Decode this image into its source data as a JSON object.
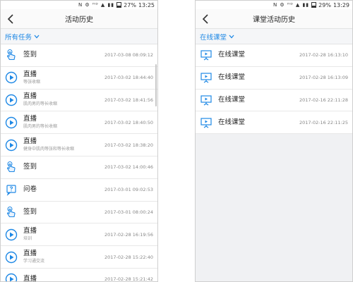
{
  "colors": {
    "accent": "#1e88e5",
    "icon_blue": "#1e88e5"
  },
  "left": {
    "status": {
      "icons": "N ⚙ ᴴᴰ ▲ ▮▮",
      "battery": "27%",
      "time": "13:25"
    },
    "title": "活动历史",
    "filter_label": "所有任务",
    "items": [
      {
        "icon": "hand-tap-icon",
        "name": "签到",
        "sub": "",
        "time": "2017-03-08 08:09:12"
      },
      {
        "icon": "play-circle-icon",
        "name": "直播",
        "sub": "等张收缩",
        "time": "2017-03-02 18:44:40"
      },
      {
        "icon": "play-circle-icon",
        "name": "直播",
        "sub": "肌肉男的等长收缩",
        "time": "2017-03-02 18:41:56"
      },
      {
        "icon": "play-circle-icon",
        "name": "直播",
        "sub": "肌肉男的等长收缩",
        "time": "2017-03-02 18:40:50"
      },
      {
        "icon": "play-circle-icon",
        "name": "直播",
        "sub": "健身中肌肉等张和等长收缩",
        "time": "2017-03-02 18:38:20"
      },
      {
        "icon": "hand-tap-icon",
        "name": "签到",
        "sub": "",
        "time": "2017-03-02 14:00:46"
      },
      {
        "icon": "questionnaire-icon",
        "name": "问卷",
        "sub": "",
        "time": "2017-03-01 09:02:53"
      },
      {
        "icon": "hand-tap-icon",
        "name": "签到",
        "sub": "",
        "time": "2017-03-01 08:00:24"
      },
      {
        "icon": "play-circle-icon",
        "name": "直播",
        "sub": "培训",
        "time": "2017-02-28 16:19:56"
      },
      {
        "icon": "play-circle-icon",
        "name": "直播",
        "sub": "学习通交流",
        "time": "2017-02-28 15:22:40"
      },
      {
        "icon": "play-circle-icon",
        "name": "直播",
        "sub": "",
        "time": "2017-02-28 15:21:42"
      }
    ]
  },
  "right": {
    "status": {
      "icons": "N ⚙ ᴴᴰ ▲ ▮▮",
      "battery": "29%",
      "time": "13:29"
    },
    "title": "课堂活动历史",
    "filter_label": "在线课堂",
    "items": [
      {
        "icon": "online-class-icon",
        "name": "在线课堂",
        "time": "2017-02-28 16:13:10"
      },
      {
        "icon": "online-class-icon",
        "name": "在线课堂",
        "time": "2017-02-28 16:13:09"
      },
      {
        "icon": "online-class-icon",
        "name": "在线课堂",
        "time": "2017-02-16 22:11:28"
      },
      {
        "icon": "online-class-icon",
        "name": "在线课堂",
        "time": "2017-02-16 22:11:25"
      }
    ]
  }
}
